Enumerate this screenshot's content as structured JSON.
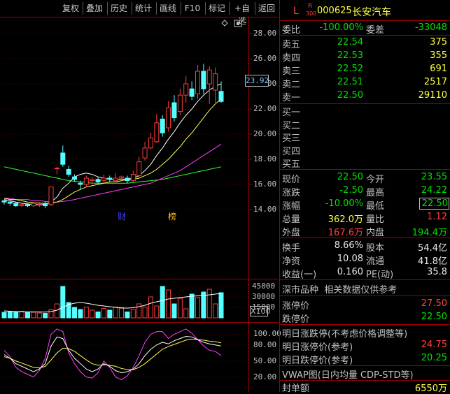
{
  "toolbar": {
    "buttons": [
      "复权",
      "叠加",
      "历史",
      "统计",
      "画线",
      "F10",
      "标记",
      "+自选",
      "返回"
    ]
  },
  "stock": {
    "marker": "L",
    "tag_top": "R",
    "tag_bottom": "300",
    "code": "000625",
    "name": "长安汽车"
  },
  "committee": {
    "ratio_label": "委比",
    "ratio": "-100.00%",
    "diff_label": "委差",
    "diff": "-33048"
  },
  "sell_orders": [
    {
      "label": "卖五",
      "price": "22.54",
      "volume": "375"
    },
    {
      "label": "卖四",
      "price": "22.53",
      "volume": "355"
    },
    {
      "label": "卖三",
      "price": "22.52",
      "volume": "691"
    },
    {
      "label": "卖二",
      "price": "22.51",
      "volume": "2517"
    },
    {
      "label": "卖一",
      "price": "22.50",
      "volume": "29110"
    }
  ],
  "buy_orders": [
    {
      "label": "买一",
      "price": "",
      "volume": ""
    },
    {
      "label": "买二",
      "price": "",
      "volume": ""
    },
    {
      "label": "买三",
      "price": "",
      "volume": ""
    },
    {
      "label": "买四",
      "price": "",
      "volume": ""
    },
    {
      "label": "买五",
      "price": "",
      "volume": ""
    }
  ],
  "quote": {
    "now_label": "现价",
    "now": "22.50",
    "open_label": "今开",
    "open": "23.55",
    "chg_label": "涨跌",
    "chg": "-2.50",
    "high_label": "最高",
    "high": "24.22",
    "pct_label": "涨幅",
    "pct": "-10.00%",
    "low_label": "最低",
    "low": "22.50",
    "vol_label": "总量",
    "vol": "362.0万",
    "vr_label": "量比",
    "vr": "1.12",
    "outer_label": "外盘",
    "outer": "167.6万",
    "inner_label": "内盘",
    "inner": "194.4万"
  },
  "fundamentals": {
    "turnover_label": "换手",
    "turnover": "8.66%",
    "equity_label": "股本",
    "equity": "54.4亿",
    "nav_label": "净资",
    "nav": "10.08",
    "float_label": "流通",
    "float": "41.8亿",
    "eps_label": "收益(一)",
    "eps": "0.160",
    "pe_label": "PE(动)",
    "pe": "35.8"
  },
  "market_title": "深市品种  相关数据仅供参考",
  "limits": {
    "up_label": "涨停价",
    "up": "27.50",
    "down_label": "跌停价",
    "down": "22.50"
  },
  "tomorrow": {
    "title": "明日涨跌停(不考虑价格调整等)",
    "up_label": "明日涨停价(参考)",
    "up": "24.75",
    "down_label": "明日跌停价(参考)",
    "down": "20.25"
  },
  "vwap_title": "VWAP图(日内均量 CDP-STD等)",
  "seal": {
    "label": "封单额",
    "value": "6550万"
  },
  "price_axis": [
    "28.00",
    "26.00",
    "24.00",
    "22.00",
    "20.00",
    "18.00",
    "16.00",
    "14.00"
  ],
  "current_price_tag": "23.92",
  "volume_axis": [
    "45000",
    "30000",
    "15000"
  ],
  "volume_unit": "X100",
  "kdj_axis": [
    "100.00",
    "80.00",
    "50.00",
    "20.00"
  ],
  "event_markers": [
    "财",
    "榜"
  ],
  "colors": {
    "up": "#ff3c3c",
    "down": "#54ffff",
    "ma1": "#ffffff",
    "ma2": "#ffff50",
    "ma3": "#ff40ff",
    "ma4": "#30ff30",
    "frame": "#a00000"
  },
  "chart_data": {
    "type": "candlestick",
    "ylim": [
      13,
      29
    ],
    "candles": [
      {
        "o": 14.7,
        "c": 14.6,
        "h": 14.8,
        "l": 14.4
      },
      {
        "o": 14.6,
        "c": 14.5,
        "h": 14.7,
        "l": 14.3
      },
      {
        "o": 14.5,
        "c": 14.3,
        "h": 14.6,
        "l": 14.2
      },
      {
        "o": 14.3,
        "c": 14.4,
        "h": 14.5,
        "l": 14.2
      },
      {
        "o": 14.4,
        "c": 14.3,
        "h": 14.5,
        "l": 14.2
      },
      {
        "o": 14.3,
        "c": 14.5,
        "h": 14.6,
        "l": 14.2
      },
      {
        "o": 14.4,
        "c": 14.4,
        "h": 14.6,
        "l": 14.2
      },
      {
        "o": 14.5,
        "c": 14.3,
        "h": 14.6,
        "l": 14.1
      },
      {
        "o": 14.4,
        "c": 15.8,
        "h": 15.8,
        "l": 14.3
      },
      {
        "o": 17.3,
        "c": 17.3,
        "h": 17.4,
        "l": 16.8
      },
      {
        "o": 18.5,
        "c": 17.6,
        "h": 19.1,
        "l": 17.4
      },
      {
        "o": 17.2,
        "c": 16.8,
        "h": 17.5,
        "l": 16.6
      },
      {
        "o": 16.6,
        "c": 16.4,
        "h": 16.8,
        "l": 16.2
      },
      {
        "o": 16.1,
        "c": 16.0,
        "h": 16.3,
        "l": 15.6
      },
      {
        "o": 16.0,
        "c": 16.5,
        "h": 16.7,
        "l": 15.8
      },
      {
        "o": 16.3,
        "c": 16.4,
        "h": 16.6,
        "l": 16.1
      },
      {
        "o": 16.4,
        "c": 16.2,
        "h": 16.6,
        "l": 16.0
      },
      {
        "o": 16.3,
        "c": 16.5,
        "h": 16.8,
        "l": 16.1
      },
      {
        "o": 16.5,
        "c": 16.4,
        "h": 16.7,
        "l": 16.2
      },
      {
        "o": 16.3,
        "c": 16.5,
        "h": 16.9,
        "l": 16.2
      },
      {
        "o": 16.5,
        "c": 16.6,
        "h": 16.7,
        "l": 16.3
      },
      {
        "o": 16.5,
        "c": 16.3,
        "h": 16.7,
        "l": 16.1
      },
      {
        "o": 16.3,
        "c": 16.8,
        "h": 17.1,
        "l": 16.2
      },
      {
        "o": 16.7,
        "c": 17.8,
        "h": 18.2,
        "l": 16.5
      },
      {
        "o": 18.1,
        "c": 18.9,
        "h": 19.4,
        "l": 17.9
      },
      {
        "o": 18.9,
        "c": 19.7,
        "h": 20.1,
        "l": 18.8
      },
      {
        "o": 19.4,
        "c": 20.9,
        "h": 21.6,
        "l": 19.3
      },
      {
        "o": 21.2,
        "c": 20.1,
        "h": 21.5,
        "l": 19.8
      },
      {
        "o": 20.5,
        "c": 22.1,
        "h": 22.6,
        "l": 20.2
      },
      {
        "o": 22.5,
        "c": 21.3,
        "h": 23.1,
        "l": 21.0
      },
      {
        "o": 21.8,
        "c": 23.1,
        "h": 23.6,
        "l": 21.5
      },
      {
        "o": 23.1,
        "c": 24.0,
        "h": 24.6,
        "l": 22.5
      },
      {
        "o": 23.6,
        "c": 23.0,
        "h": 24.2,
        "l": 22.7
      },
      {
        "o": 23.2,
        "c": 25.0,
        "h": 25.5,
        "l": 22.8
      },
      {
        "o": 25.0,
        "c": 23.6,
        "h": 25.6,
        "l": 23.2
      },
      {
        "o": 24.0,
        "c": 25.1,
        "h": 25.4,
        "l": 22.4
      },
      {
        "o": 23.5,
        "c": 24.8,
        "h": 25.3,
        "l": 22.5
      },
      {
        "o": 23.4,
        "c": 22.6,
        "h": 24.2,
        "l": 22.5
      }
    ],
    "ma_white": [
      14.8,
      14.7,
      14.6,
      14.5,
      14.45,
      14.4,
      14.4,
      14.4,
      14.6,
      15.0,
      15.7,
      16.1,
      16.6,
      16.8,
      16.9,
      16.8,
      16.6,
      16.5,
      16.4,
      16.4,
      16.4,
      16.4,
      16.5,
      16.7,
      17.1,
      17.6,
      18.3,
      18.9,
      19.6,
      20.2,
      20.9,
      21.5,
      22.0,
      22.6,
      23.1,
      23.5,
      23.8,
      24.0
    ],
    "ma_yellow": [
      14.9,
      14.8,
      14.8,
      14.7,
      14.6,
      14.55,
      14.5,
      14.5,
      14.5,
      14.6,
      14.8,
      15.1,
      15.4,
      15.6,
      15.8,
      15.9,
      16.0,
      16.1,
      16.2,
      16.2,
      16.3,
      16.4,
      16.4,
      16.5,
      16.7,
      16.9,
      17.2,
      17.6,
      18.0,
      18.5,
      19.0,
      19.6,
      20.1,
      20.7,
      21.3,
      21.9,
      22.4,
      22.8
    ],
    "ma_magenta": [
      14.9,
      14.9,
      14.8,
      14.8,
      14.8,
      14.7,
      14.7,
      14.65,
      14.6,
      14.6,
      14.65,
      14.7,
      14.8,
      14.9,
      15.0,
      15.1,
      15.2,
      15.3,
      15.4,
      15.5,
      15.6,
      15.7,
      15.8,
      15.9,
      16.0,
      16.1,
      16.3,
      16.5,
      16.7,
      16.9,
      17.1,
      17.4,
      17.7,
      18.0,
      18.3,
      18.6,
      18.9,
      19.2
    ],
    "ma_green": [
      17.4,
      17.3,
      17.2,
      17.1,
      17.0,
      16.9,
      16.8,
      16.7,
      16.6,
      16.5,
      16.4,
      16.3,
      16.25,
      16.2,
      16.15,
      16.1,
      16.1,
      16.1,
      16.1,
      16.1,
      16.1,
      16.1,
      16.15,
      16.2,
      16.25,
      16.3,
      16.35,
      16.4,
      16.5,
      16.6,
      16.7,
      16.8,
      16.9,
      17.0,
      17.1,
      17.2,
      17.3,
      17.4
    ],
    "volume": [
      8000,
      8500,
      9000,
      9500,
      7500,
      8000,
      7000,
      6500,
      12000,
      20000,
      45000,
      22000,
      15000,
      12000,
      15500,
      11000,
      8500,
      13500,
      11000,
      15500,
      15000,
      8500,
      12000,
      20000,
      15500,
      30000,
      17000,
      45000,
      40000,
      20000,
      28000,
      13000,
      34000,
      29000,
      37000,
      41000,
      20000,
      36000
    ],
    "vol_ma": [
      10000,
      9500,
      9000,
      8800,
      8600,
      8500,
      8400,
      8300,
      9000,
      11000,
      15000,
      19000,
      21000,
      22000,
      21000,
      19500,
      18000,
      17000,
      16000,
      15000,
      14000,
      14000,
      14500,
      16000,
      18000,
      21000,
      23000,
      25000,
      27000,
      28000,
      29000,
      30000,
      31000,
      31500,
      32000,
      33000,
      34000,
      35000
    ],
    "kdj_k": [
      62,
      55,
      45,
      40,
      35,
      30,
      35,
      45,
      78,
      95,
      92,
      70,
      55,
      45,
      35,
      30,
      35,
      45,
      40,
      32,
      28,
      30,
      35,
      45,
      60,
      72,
      80,
      85,
      82,
      88,
      92,
      96,
      95,
      90,
      85,
      82,
      80,
      78
    ],
    "kdj_d": [
      58,
      55,
      50,
      46,
      42,
      38,
      37,
      40,
      52,
      65,
      74,
      73,
      68,
      60,
      52,
      45,
      42,
      43,
      42,
      40,
      36,
      34,
      34,
      38,
      45,
      54,
      63,
      72,
      77,
      81,
      85,
      89,
      91,
      90,
      89,
      87,
      86,
      84
    ],
    "kdj_j": [
      70,
      58,
      38,
      30,
      25,
      20,
      32,
      55,
      100,
      110,
      105,
      65,
      45,
      30,
      20,
      18,
      28,
      50,
      38,
      20,
      15,
      22,
      38,
      60,
      85,
      100,
      105,
      105,
      92,
      100,
      105,
      110,
      102,
      90,
      78,
      70,
      68,
      60
    ]
  }
}
